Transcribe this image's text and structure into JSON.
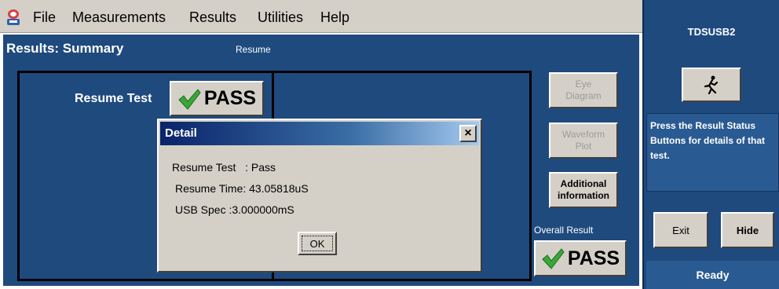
{
  "menu": {
    "items": [
      "File",
      "Measurements",
      "Results",
      "Utilities",
      "Help"
    ]
  },
  "main": {
    "title": "Results: Summary",
    "test_name": "Resume",
    "resume_test_label": "Resume Test",
    "resume_test_result": "PASS",
    "side_buttons": {
      "eye_diagram": "Eye\nDiagram",
      "waveform_plot": "Waveform\nPlot",
      "additional_info": "Additional\ninformation"
    },
    "overall_result_label": "Overall Result",
    "overall_result": "PASS"
  },
  "dialog": {
    "title": "Detail",
    "close_glyph": "×",
    "line1": "Resume Test   : Pass",
    "line2": "Resume Time: 43.05818uS",
    "line3": "USB Spec :3.000000mS",
    "ok_label": "OK"
  },
  "right_panel": {
    "app_name": "TDSUSB2",
    "status_message": "Press the Result Status Buttons for details of that test.",
    "exit_label": "Exit",
    "hide_label": "Hide",
    "status": "Ready"
  },
  "icons": {
    "app_icon": "tektronix-app-icon",
    "pass_icon": "checkmark-icon",
    "run_icon": "running-man-icon"
  },
  "colors": {
    "panel_blue": "#1f4a7e",
    "check_green": "#3aa63a"
  }
}
